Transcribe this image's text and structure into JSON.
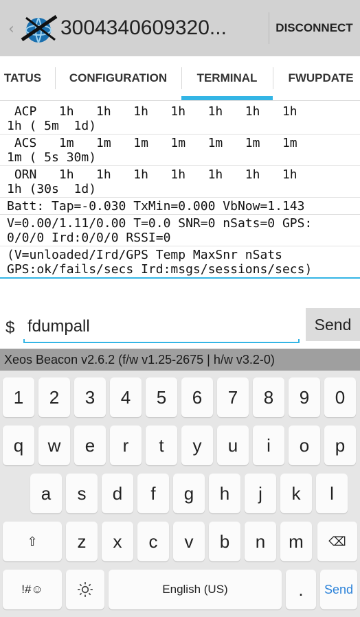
{
  "header": {
    "back_glyph": "‹",
    "title": "3004340609320...",
    "disconnect_label": "DISCONNECT",
    "logo_icon": "globe-satellite-logo-icon"
  },
  "tabs": [
    {
      "label": "STATUS",
      "shown": "TATUS"
    },
    {
      "label": "CONFIGURATION"
    },
    {
      "label": "TERMINAL",
      "selected": true
    },
    {
      "label": "FWUPDATE"
    }
  ],
  "terminal": {
    "lines": [
      " ACP   1h   1h   1h   1h   1h   1h   1h\n1h ( 5m  1d)",
      " ACS   1m   1m   1m   1m   1m   1m   1m\n1m ( 5s 30m)",
      " ORN   1h   1h   1h   1h   1h   1h   1h\n1h (30s  1d)",
      "Batt: Tap=-0.030 TxMin=0.000 VbNow=1.143",
      "V=0.00/1.11/0.00 T=0.0 SNR=0 nSats=0 GPS:\n0/0/0 Ird:0/0/0 RSSI=0",
      "(V=unloaded/Ird/GPS Temp MaxSnr nSats\nGPS:ok/fails/secs Ird:msgs/sessions/secs)"
    ]
  },
  "command": {
    "prompt": "$",
    "value": "fdumpall",
    "send_label": "Send"
  },
  "footer": {
    "version_text": "Xeos Beacon v2.6.2 (f/w v1.25-2675 | h/w v3.2-0)"
  },
  "keyboard": {
    "row1": [
      "1",
      "2",
      "3",
      "4",
      "5",
      "6",
      "7",
      "8",
      "9",
      "0"
    ],
    "row2": [
      "q",
      "w",
      "e",
      "r",
      "t",
      "y",
      "u",
      "i",
      "o",
      "p"
    ],
    "row3": [
      "a",
      "s",
      "d",
      "f",
      "g",
      "h",
      "j",
      "k",
      "l"
    ],
    "row4": [
      "z",
      "x",
      "c",
      "v",
      "b",
      "n",
      "m"
    ],
    "shift_glyph": "⇧",
    "backspace_glyph": "⌫",
    "symbols_label": "!#☺",
    "space_label": "English (US)",
    "period_label": ".",
    "send_label": "Send"
  },
  "colors": {
    "accent": "#33b5e5",
    "actionbar": "#d2d2d2",
    "footer": "#9f9f9f",
    "keyboard_bg": "#e6e6e6"
  }
}
